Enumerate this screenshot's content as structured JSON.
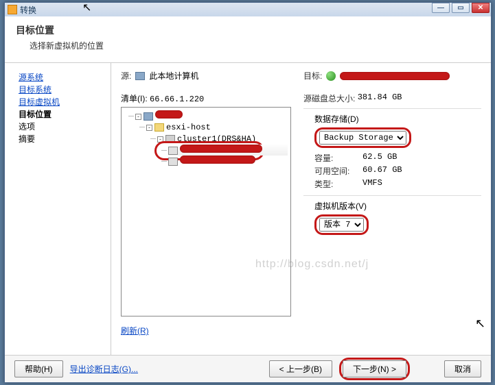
{
  "titlebar": {
    "title": "转换"
  },
  "header": {
    "title": "目标位置",
    "subtitle": "选择新虚拟机的位置"
  },
  "sidebar": {
    "items": [
      {
        "label": "源系统",
        "state": "link"
      },
      {
        "label": "目标系统",
        "state": "link"
      },
      {
        "label": "目标虚拟机",
        "state": "link"
      },
      {
        "label": "目标位置",
        "state": "current"
      },
      {
        "label": "选项",
        "state": "plain"
      },
      {
        "label": "摘要",
        "state": "plain"
      }
    ]
  },
  "source": {
    "label": "源:",
    "value": "此本地计算机"
  },
  "target": {
    "label": "目标:"
  },
  "inventory": {
    "label": "清单(I):",
    "ip": "66.66.1.220",
    "nodes": {
      "folder": "esxi-host",
      "cluster": "cluster1(DRS&HA)"
    },
    "refresh": "刷新(R)"
  },
  "disk": {
    "total_label": "源磁盘总大小:",
    "total_value": "381.84 GB",
    "datastore_label": "数据存储(D)",
    "datastore_value": "Backup Storage",
    "capacity_label": "容量:",
    "capacity_value": "62.5 GB",
    "free_label": "可用空间:",
    "free_value": "60.67 GB",
    "type_label": "类型:",
    "type_value": "VMFS"
  },
  "vmver": {
    "label": "虚拟机版本(V)",
    "value": "版本 7"
  },
  "footer": {
    "help": "帮助(H)",
    "export": "导出诊断日志(G)...",
    "back": "< 上一步(B)",
    "next": "下一步(N) >",
    "cancel": "取消"
  },
  "watermark": "http://blog.csdn.net/j"
}
